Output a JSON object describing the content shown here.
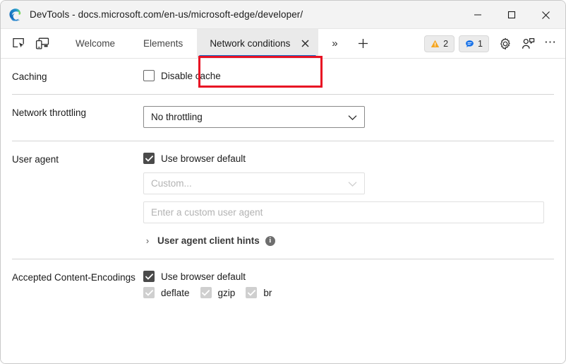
{
  "window": {
    "title": "DevTools - docs.microsoft.com/en-us/microsoft-edge/developer/",
    "logo_icon": "edge-logo-icon",
    "controls": {
      "minimize": "minimize-icon",
      "maximize": "maximize-icon",
      "close": "close-icon"
    }
  },
  "toolbar": {
    "inspect_icon": "inspect-element-icon",
    "device_icon": "device-emulation-icon",
    "tabs": [
      {
        "label": "Welcome",
        "active": false
      },
      {
        "label": "Elements",
        "active": false
      },
      {
        "label": "Network conditions",
        "active": true,
        "close_icon": "close-tab-icon"
      }
    ],
    "more_tabs_icon": "chevron-double-right-icon",
    "more_tabs_label": "»",
    "add_tab_icon": "plus-icon",
    "badges": [
      {
        "name": "warnings",
        "icon": "warning-triangle-icon",
        "count": "2",
        "color": "#f5a623"
      },
      {
        "name": "messages",
        "icon": "message-bubble-icon",
        "count": "1",
        "color": "#1a73e8"
      }
    ],
    "settings_icon": "gear-icon",
    "feedback_icon": "feedback-icon",
    "more_options_icon": "more-options-icon",
    "more_options_label": "⋯"
  },
  "annotation": {
    "name": "red-highlight-box",
    "color": "#e81123",
    "targets": "Network conditions tab"
  },
  "panel": {
    "sections": {
      "caching": {
        "label": "Caching",
        "disable_cache": {
          "label": "Disable cache",
          "checked": false
        }
      },
      "throttling": {
        "label": "Network throttling",
        "select_value": "No throttling",
        "chevron": "chevron-down-icon"
      },
      "user_agent": {
        "label": "User agent",
        "use_browser_default": {
          "label": "Use browser default",
          "checked": true
        },
        "custom_select_value": "Custom...",
        "custom_input_placeholder": "Enter a custom user agent",
        "custom_input_value": "",
        "client_hints": {
          "label": "User agent client hints",
          "arrow": "›",
          "info_icon": "info-icon",
          "info_glyph": "i",
          "expanded": false
        }
      },
      "content_encodings": {
        "label": "Accepted Content-Encodings",
        "use_browser_default": {
          "label": "Use browser default",
          "checked": true
        },
        "encodings": [
          {
            "label": "deflate",
            "checked": true,
            "disabled": true
          },
          {
            "label": "gzip",
            "checked": true,
            "disabled": true
          },
          {
            "label": "br",
            "checked": true,
            "disabled": true
          }
        ]
      }
    }
  }
}
